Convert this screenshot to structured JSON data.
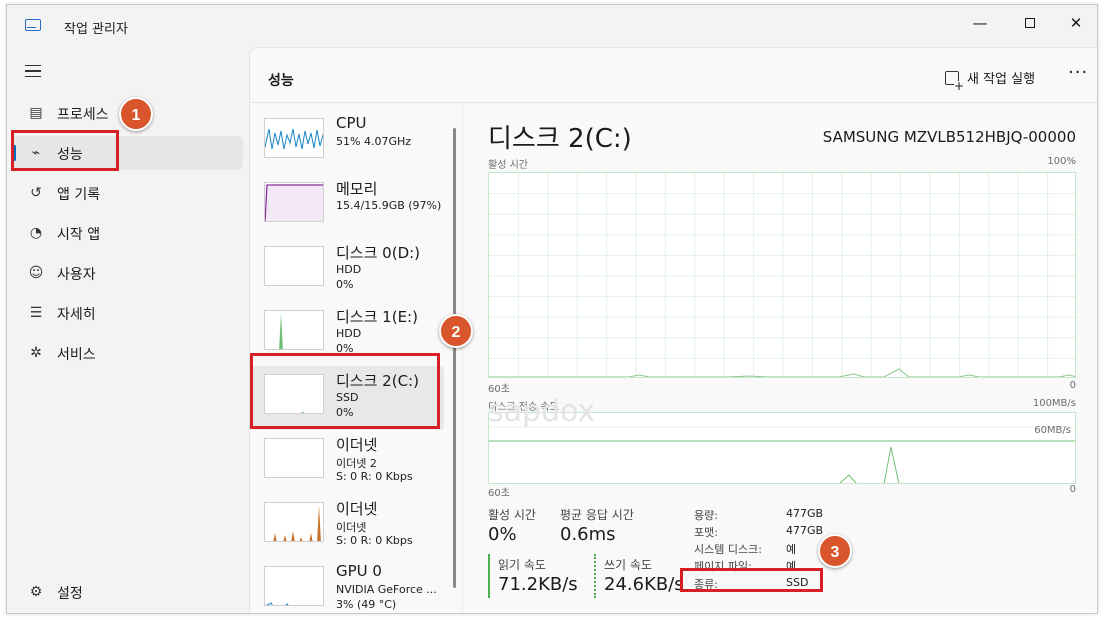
{
  "window": {
    "title": "작업 관리자"
  },
  "sidebar": {
    "items": [
      {
        "label": "프로세스",
        "icon": "processes-icon"
      },
      {
        "label": "성능",
        "icon": "performance-icon"
      },
      {
        "label": "앱 기록",
        "icon": "history-icon"
      },
      {
        "label": "시작 앱",
        "icon": "startup-icon"
      },
      {
        "label": "사용자",
        "icon": "users-icon"
      },
      {
        "label": "자세히",
        "icon": "details-icon"
      },
      {
        "label": "서비스",
        "icon": "services-icon"
      }
    ],
    "settings_label": "설정"
  },
  "header": {
    "page_title": "성능",
    "new_task_label": "새 작업 실행",
    "more_label": "···"
  },
  "devices": [
    {
      "name": "CPU",
      "line2": "51% 4.07GHz",
      "line3": ""
    },
    {
      "name": "메모리",
      "line2": "15.4/15.9GB (97%)",
      "line3": ""
    },
    {
      "name": "디스크 0(D:)",
      "line2": "HDD",
      "line3": "0%"
    },
    {
      "name": "디스크 1(E:)",
      "line2": "HDD",
      "line3": "0%"
    },
    {
      "name": "디스크 2(C:)",
      "line2": "SSD",
      "line3": "0%"
    },
    {
      "name": "이더넷",
      "line2": "이더넷 2",
      "line3": "S: 0 R: 0 Kbps"
    },
    {
      "name": "이더넷",
      "line2": "이더넷",
      "line3": "S: 0 R: 0 Kbps"
    },
    {
      "name": "GPU 0",
      "line2": "NVIDIA GeForce ...",
      "line3": "3% (49 °C)"
    }
  ],
  "detail": {
    "title": "디스크 2(C:)",
    "model": "SAMSUNG MZVLB512HBJQ-00000",
    "graph1": {
      "label": "활성 시간",
      "max": "100%",
      "time": "60초",
      "min": "0"
    },
    "graph2": {
      "label": "디스크 전송 속도",
      "max": "100MB/s",
      "line": "60MB/s",
      "time": "60초",
      "min": "0"
    },
    "watermark": "sapdox",
    "stats": {
      "active_time_label": "활성 시간",
      "active_time": "0%",
      "response_label": "평균 응답 시간",
      "response": "0.6ms",
      "read_label": "읽기 속도",
      "read": "71.2KB/s",
      "write_label": "쓰기 속도",
      "write": "24.6KB/s"
    },
    "props": [
      {
        "k": "용량:",
        "v": "477GB"
      },
      {
        "k": "포맷:",
        "v": "477GB"
      },
      {
        "k": "시스템 디스크:",
        "v": "예"
      },
      {
        "k": "페이지 파일:",
        "v": "예"
      },
      {
        "k": "종류:",
        "v": "SSD"
      }
    ]
  },
  "annotations": {
    "b1": "1",
    "b2": "2",
    "b3": "3"
  },
  "colors": {
    "accent": "#0067c0",
    "graph": "#4caf50",
    "annotation": "#d71f26",
    "badge": "#d9552b"
  }
}
